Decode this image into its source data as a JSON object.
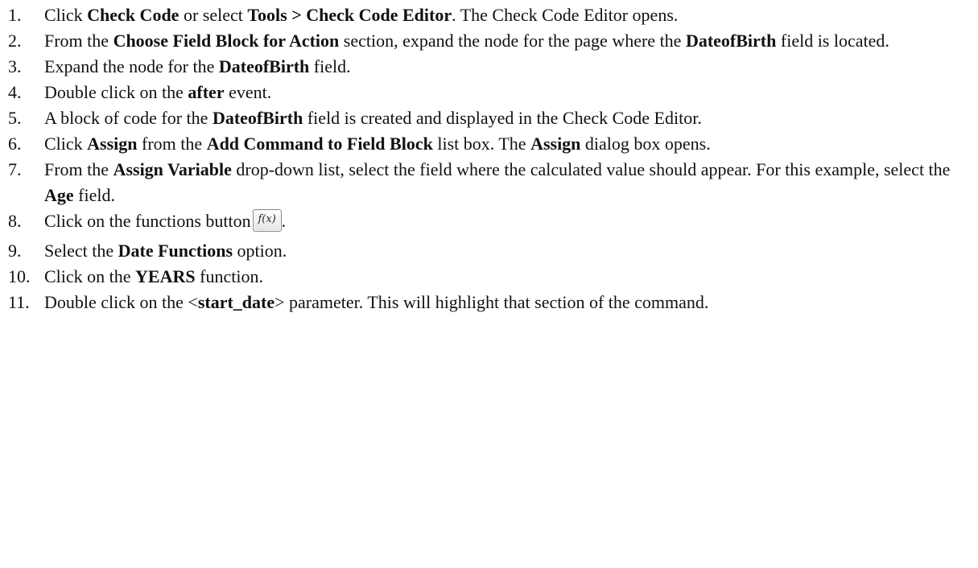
{
  "steps": [
    {
      "number": "1.",
      "parts": [
        {
          "text": "Click "
        },
        {
          "text": "Check Code",
          "bold": true
        },
        {
          "text": " or select "
        },
        {
          "text": "Tools > Check Code Editor",
          "bold": true
        },
        {
          "text": ". The Check Code Editor opens."
        }
      ]
    },
    {
      "number": "2.",
      "parts": [
        {
          "text": "From the "
        },
        {
          "text": "Choose Field Block for Action",
          "bold": true
        },
        {
          "text": " section, expand the node for the page where the "
        },
        {
          "text": "DateofBirth",
          "bold": true
        },
        {
          "text": " field is located."
        }
      ]
    },
    {
      "number": "3.",
      "parts": [
        {
          "text": "Expand the node for the "
        },
        {
          "text": "DateofBirth",
          "bold": true
        },
        {
          "text": " field."
        }
      ]
    },
    {
      "number": "4.",
      "parts": [
        {
          "text": "Double click on the "
        },
        {
          "text": "after",
          "bold": true
        },
        {
          "text": " event."
        }
      ]
    },
    {
      "number": "5.",
      "parts": [
        {
          "text": "A block of code for the "
        },
        {
          "text": "DateofBirth",
          "bold": true
        },
        {
          "text": " field is created and displayed in the Check Code Editor."
        }
      ]
    },
    {
      "number": "6.",
      "parts": [
        {
          "text": "Click "
        },
        {
          "text": "Assign",
          "bold": true
        },
        {
          "text": " from the "
        },
        {
          "text": "Add Command to Field Block",
          "bold": true
        },
        {
          "text": " list box. The "
        },
        {
          "text": "Assign",
          "bold": true
        },
        {
          "text": " dialog box opens."
        }
      ]
    },
    {
      "number": "7.",
      "parts": [
        {
          "text": "From the "
        },
        {
          "text": "Assign Variable",
          "bold": true
        },
        {
          "text": " drop-down list, select the field where the calculated value should appear. For this example, select the "
        },
        {
          "text": "Age",
          "bold": true
        },
        {
          "text": " field."
        }
      ]
    },
    {
      "number": "8.",
      "parts": [
        {
          "text": "Click on the functions button"
        },
        {
          "button": "f(x)"
        },
        {
          "text": "."
        }
      ]
    },
    {
      "number": "9.",
      "parts": [
        {
          "text": "Select the "
        },
        {
          "text": "Date Functions",
          "bold": true
        },
        {
          "text": " option."
        }
      ]
    },
    {
      "number": "10.",
      "parts": [
        {
          "text": "Click on the "
        },
        {
          "text": "YEARS",
          "bold": true
        },
        {
          "text": " function."
        }
      ]
    },
    {
      "number": "11.",
      "parts": [
        {
          "text": "Double click on the <"
        },
        {
          "text": "start_date",
          "bold": true
        },
        {
          "text": "> parameter.  This will highlight that section of the command."
        }
      ]
    }
  ]
}
